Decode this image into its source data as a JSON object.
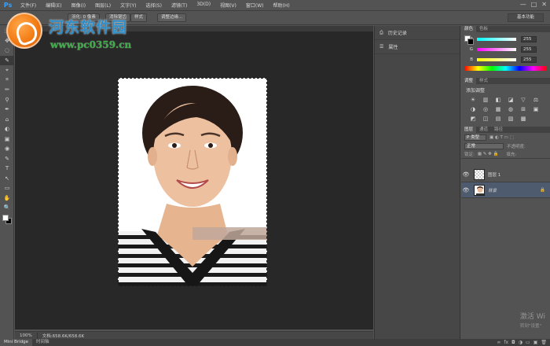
{
  "app": {
    "logo": "Ps"
  },
  "menu": [
    "文件(F)",
    "编辑(E)",
    "图像(I)",
    "图层(L)",
    "文字(Y)",
    "选择(S)",
    "滤镜(T)",
    "3D(D)",
    "视图(V)",
    "窗口(W)",
    "帮助(H)"
  ],
  "window_controls": [
    "—",
    "□",
    "✕"
  ],
  "options_bar": {
    "feather_label": "羽化: 0 像素",
    "antialias_label": "消除锯齿",
    "style_button": "样式",
    "refine_edge_button": "调整边缘...",
    "workspace_button": "基本功能"
  },
  "watermark": {
    "title": "河东软件园",
    "url": "www.pc0359.cn"
  },
  "tools": [
    "⬚",
    "✥",
    "◌",
    "✎",
    "⌖",
    "⌗",
    "✏",
    "⚲",
    "✒",
    "⌂",
    "◐",
    "▣",
    "◉",
    "✎",
    "T",
    "↖",
    "▭",
    "✋",
    "🔍"
  ],
  "status": {
    "zoom": "100%",
    "doc": "文档:658.6K/658.6K"
  },
  "bottom_tabs": [
    "Mini Bridge",
    "时间轴"
  ],
  "side_strip": [
    {
      "icon": "history-icon",
      "label": "历史记录"
    },
    {
      "icon": "properties-icon",
      "label": "属性"
    }
  ],
  "color_panel": {
    "tabs": [
      "颜色",
      "色板"
    ],
    "channels": [
      {
        "label": "R",
        "value": "255",
        "gradient": "linear-gradient(90deg,#00ffff,#ffffff)"
      },
      {
        "label": "G",
        "value": "255",
        "gradient": "linear-gradient(90deg,#ff00ff,#ffffff)"
      },
      {
        "label": "B",
        "value": "255",
        "gradient": "linear-gradient(90deg,#ffff00,#ffffff)"
      }
    ]
  },
  "adjustments_panel": {
    "tabs": [
      "调整",
      "样式"
    ],
    "title": "添加调整",
    "icons": [
      "☀",
      "▥",
      "◧",
      "◪",
      "▽",
      "⚖",
      "◑",
      "◎",
      "▦",
      "◍",
      "⊞",
      "▣",
      "◩",
      "◫",
      "▤",
      "▧",
      "▩"
    ]
  },
  "layers_panel": {
    "tabs": [
      "图层",
      "通道",
      "路径"
    ],
    "kind": "P 类型",
    "mode": "正常",
    "opacity_label": "不透明度:",
    "lock_label": "锁定:",
    "fill_label": "填充:",
    "layers": [
      {
        "name": "图层 1",
        "selected": false
      },
      {
        "name": "背景",
        "selected": true
      }
    ]
  },
  "activate_windows": {
    "line1": "激活 Wi",
    "line2": "转到\"设置\""
  }
}
